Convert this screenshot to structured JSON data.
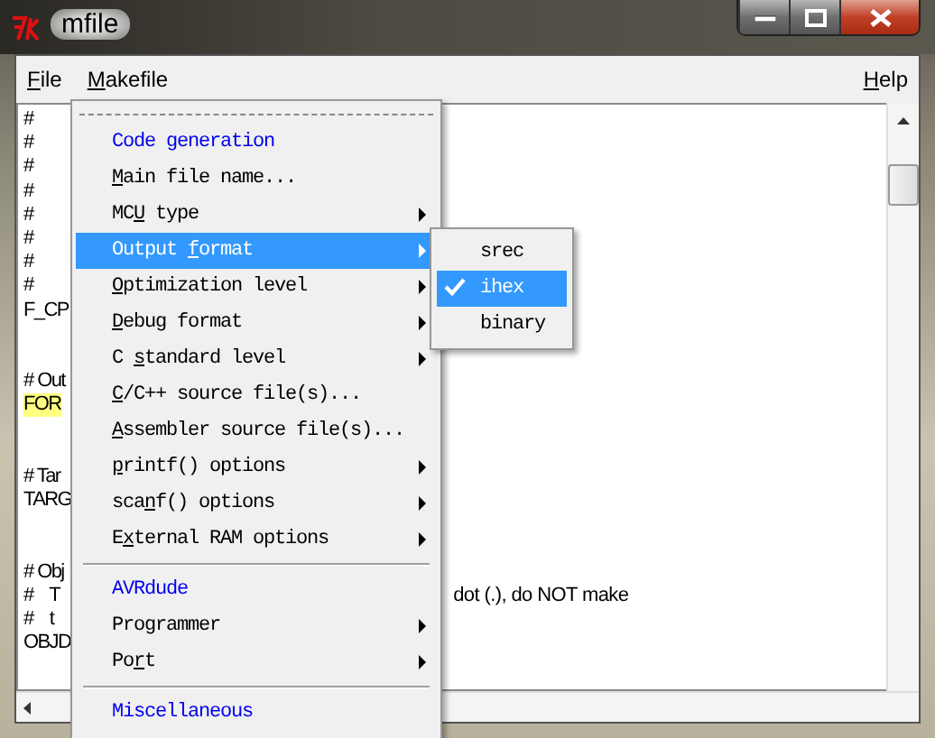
{
  "window": {
    "title": "mfile"
  },
  "menubar": [
    {
      "key": "F",
      "after": "ile"
    },
    {
      "key": "M",
      "after": "akefile"
    },
    {
      "key": "H",
      "after": "elp"
    }
  ],
  "editor": {
    "blocks": [
      {
        "lines": [
          {
            "text": "#"
          },
          {
            "text": "#"
          },
          {
            "text": "#"
          },
          {
            "text": "#"
          },
          {
            "text": "#"
          },
          {
            "text": "#"
          },
          {
            "text": "#"
          },
          {
            "text": "#"
          },
          {
            "text": "F_CP"
          }
        ]
      },
      {
        "lines": [
          {
            "text": "# Out"
          },
          {
            "text": "FOR",
            "highlighted": true
          }
        ]
      },
      {
        "lines": [
          {
            "text": "# Tar"
          },
          {
            "text": "TARG"
          }
        ]
      },
      {
        "lines": [
          {
            "text": "# Obj"
          },
          {
            "text": "#    T",
            "tail": "dot (.), do NOT make"
          },
          {
            "text": "#    t"
          },
          {
            "text": "OBJD"
          }
        ]
      }
    ]
  },
  "makefile_menu": {
    "items": [
      {
        "kind": "tearoff"
      },
      {
        "kind": "header",
        "before": "Code generation",
        "selected": false
      },
      {
        "kind": "command",
        "key": "M",
        "after": "ain file name...",
        "selected": false
      },
      {
        "kind": "submenu",
        "before": "MC",
        "key": "U",
        "after": " type",
        "selected": false
      },
      {
        "kind": "submenu",
        "before": "Output ",
        "key": "f",
        "after": "ormat",
        "selected": true
      },
      {
        "kind": "submenu",
        "key": "O",
        "after": "ptimization level",
        "selected": false
      },
      {
        "kind": "submenu",
        "key": "D",
        "after": "ebug format",
        "selected": false
      },
      {
        "kind": "submenu",
        "before": "C ",
        "key": "s",
        "after": "tandard level",
        "selected": false
      },
      {
        "kind": "command",
        "key": "C",
        "after": "/C++ source file(s)...",
        "selected": false
      },
      {
        "kind": "command",
        "key": "A",
        "after": "ssembler source file(s)...",
        "selected": false
      },
      {
        "kind": "submenu",
        "key": "p",
        "after": "rintf() options",
        "selected": false
      },
      {
        "kind": "submenu",
        "before": "sca",
        "key": "n",
        "after": "f() options",
        "selected": false
      },
      {
        "kind": "submenu",
        "before": "E",
        "key": "x",
        "after": "ternal RAM options",
        "selected": false
      },
      {
        "kind": "separator"
      },
      {
        "kind": "header",
        "before": "AVRdude",
        "selected": false
      },
      {
        "kind": "submenu",
        "before": "Programmer",
        "selected": false
      },
      {
        "kind": "submenu",
        "before": "Po",
        "key": "r",
        "after": "t",
        "selected": false
      },
      {
        "kind": "separator"
      },
      {
        "kind": "header",
        "before": "Miscellaneous",
        "selected": false
      }
    ]
  },
  "output_submenu": {
    "items": [
      {
        "label": "srec",
        "checked": false,
        "selected": false
      },
      {
        "label": "ihex",
        "checked": true,
        "selected": true
      },
      {
        "label": "binary",
        "checked": false,
        "selected": false
      }
    ]
  }
}
